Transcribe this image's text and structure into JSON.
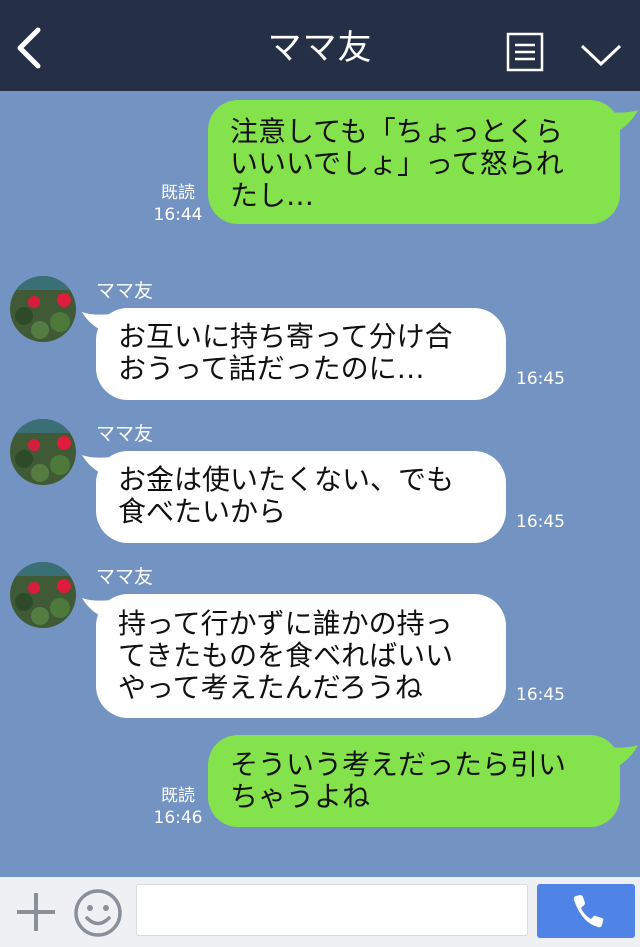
{
  "header": {
    "title": "ママ友",
    "back_icon": "chevron-left-icon",
    "menu_icon": "menu-icon",
    "expand_icon": "chevron-down-icon"
  },
  "messages": [
    {
      "direction": "out",
      "lines": [
        "注意しても「ちょっとくら",
        "いいいでしょ」って怒られ",
        "たし…"
      ],
      "read_label": "既読",
      "time": "16:44"
    },
    {
      "direction": "in",
      "sender": "ママ友",
      "lines": [
        "お互いに持ち寄って分け合",
        "おうって話だったのに…"
      ],
      "time": "16:45"
    },
    {
      "direction": "in",
      "sender": "ママ友",
      "lines": [
        "お金は使いたくない、でも",
        "食べたいから"
      ],
      "time": "16:45"
    },
    {
      "direction": "in",
      "sender": "ママ友",
      "lines": [
        "持って行かずに誰かの持っ",
        "てきたものを食べればいい",
        "やって考えたんだろうね"
      ],
      "time": "16:45"
    },
    {
      "direction": "out",
      "lines": [
        "そういう考えだったら引い",
        "ちゃうよね"
      ],
      "read_label": "既読",
      "time": "16:46"
    }
  ],
  "composer": {
    "input_value": "",
    "plus_icon": "plus-icon",
    "emoji_icon": "emoji-icon",
    "call_icon": "phone-icon"
  },
  "colors": {
    "background": "#7393c3",
    "header": "#252f45",
    "outgoing_bubble": "#84e24c",
    "incoming_bubble": "#ffffff",
    "call_button": "#4f84e6"
  }
}
